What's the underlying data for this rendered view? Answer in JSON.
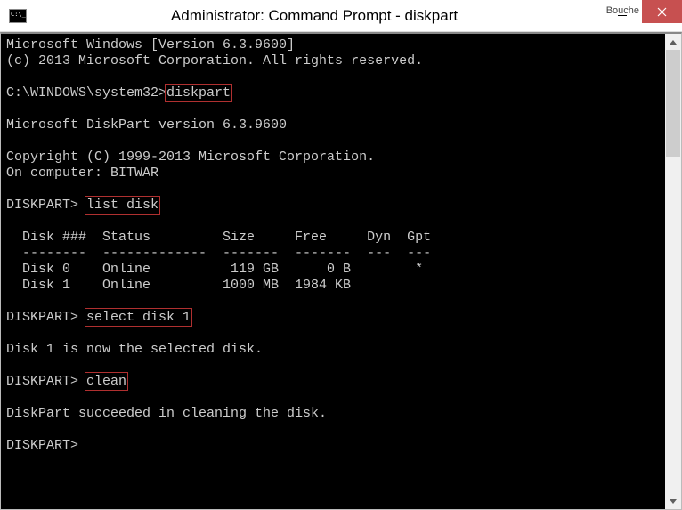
{
  "titlebar": {
    "title": "Administrator: Command Prompt - diskpart",
    "extra": "Bouche"
  },
  "terminal": {
    "line1": "Microsoft Windows [Version 6.3.9600]",
    "line2": "(c) 2013 Microsoft Corporation. All rights reserved.",
    "blank": " ",
    "prompt_sys": "C:\\WINDOWS\\system32>",
    "cmd_diskpart": "diskpart",
    "line_dp_ver": "Microsoft DiskPart version 6.3.9600",
    "line_copy": "Copyright (C) 1999-2013 Microsoft Corporation.",
    "line_comp": "On computer: BITWAR",
    "prompt_dp": "DISKPART> ",
    "cmd_list": "list disk",
    "head_disks": "  Disk ###  Status         Size     Free     Dyn  Gpt",
    "head_sep": "  --------  -------------  -------  -------  ---  ---",
    "row_d0": "  Disk 0    Online          119 GB      0 B        *",
    "row_d1": "  Disk 1    Online         1000 MB  1984 KB",
    "cmd_select": "select disk 1",
    "resp_select": "Disk 1 is now the selected disk.",
    "cmd_clean": "clean",
    "resp_clean": "DiskPart succeeded in cleaning the disk.",
    "prompt_final": "DISKPART>"
  }
}
